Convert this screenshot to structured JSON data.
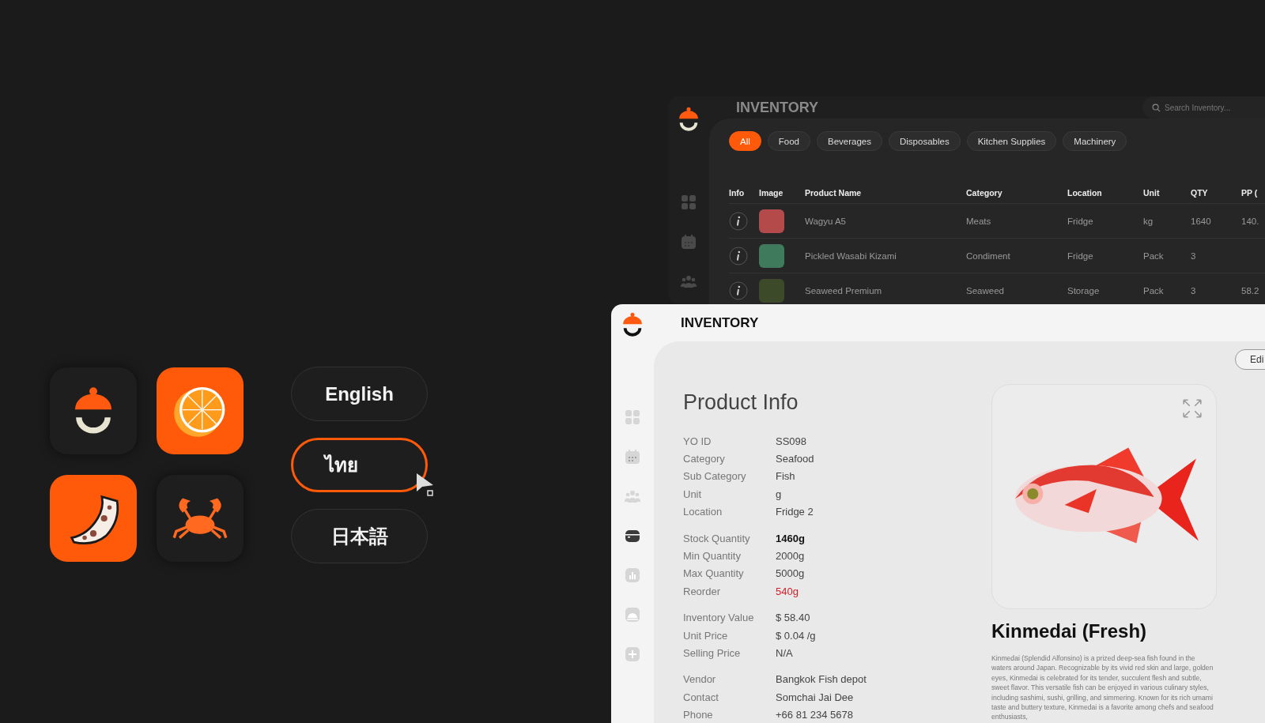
{
  "app_icons": [
    {
      "kind": "cloche"
    },
    {
      "kind": "orange"
    },
    {
      "kind": "pizza"
    },
    {
      "kind": "crab"
    }
  ],
  "languages": [
    {
      "label": "English",
      "selected": false
    },
    {
      "label": "ไทย",
      "selected": true
    },
    {
      "label": "日本語",
      "selected": false
    }
  ],
  "inventory_window": {
    "title": "INVENTORY",
    "search": {
      "placeholder": "Search Inventory..."
    },
    "filters": [
      {
        "label": "All",
        "selected": true
      },
      {
        "label": "Food",
        "selected": false
      },
      {
        "label": "Beverages",
        "selected": false
      },
      {
        "label": "Disposables",
        "selected": false
      },
      {
        "label": "Kitchen Supplies",
        "selected": false
      },
      {
        "label": "Machinery",
        "selected": false
      }
    ],
    "nav": [
      {
        "kind": "grid"
      },
      {
        "kind": "calendar"
      },
      {
        "kind": "people"
      }
    ],
    "table": {
      "columns": [
        "Info",
        "Image",
        "Product Name",
        "Category",
        "Location",
        "Unit",
        "QTY",
        "PP ("
      ],
      "rows": [
        {
          "name": "Wagyu A5",
          "category": "Meats",
          "location": "Fridge",
          "unit": "kg",
          "qty": "1640",
          "pp": "140."
        },
        {
          "name": "Pickled Wasabi Kizami",
          "category": "Condiment",
          "location": "Fridge",
          "unit": "Pack",
          "qty": "3",
          "pp": ""
        },
        {
          "name": "Seaweed Premium",
          "category": "Seaweed",
          "location": "Storage",
          "unit": "Pack",
          "qty": "3",
          "pp": "58.2"
        }
      ]
    }
  },
  "product_window": {
    "title": "INVENTORY",
    "edit_button": "Edi",
    "nav": [
      {
        "kind": "grid",
        "selected": false
      },
      {
        "kind": "calendar",
        "selected": false
      },
      {
        "kind": "people",
        "selected": false
      },
      {
        "kind": "box",
        "selected": true
      },
      {
        "kind": "chart",
        "selected": false
      },
      {
        "kind": "cloche",
        "selected": false
      },
      {
        "kind": "plus",
        "selected": false
      }
    ],
    "heading": "Product Info",
    "sections": [
      [
        {
          "label": "YO ID",
          "value": "SS098",
          "kind": "normal"
        },
        {
          "label": "Category",
          "value": "Seafood",
          "kind": "normal"
        },
        {
          "label": "Sub Category",
          "value": "Fish",
          "kind": "normal"
        },
        {
          "label": "Unit",
          "value": "g",
          "kind": "normal"
        },
        {
          "label": "Location",
          "value": "Fridge 2",
          "kind": "normal"
        }
      ],
      [
        {
          "label": "Stock Quantity",
          "value": "1460g",
          "kind": "emphasis"
        },
        {
          "label": "Min Quantity",
          "value": "2000g",
          "kind": "normal"
        },
        {
          "label": "Max Quantity",
          "value": "5000g",
          "kind": "normal"
        },
        {
          "label": "Reorder",
          "value": "540g",
          "kind": "alert"
        }
      ],
      [
        {
          "label": "Inventory Value",
          "value": "$ 58.40",
          "kind": "normal"
        },
        {
          "label": "Unit Price",
          "value": "$ 0.04 /g",
          "kind": "normal"
        },
        {
          "label": "Selling Price",
          "value": "N/A",
          "kind": "normal"
        }
      ],
      [
        {
          "label": "Vendor",
          "value": "Bangkok Fish depot",
          "kind": "normal"
        },
        {
          "label": "Contact",
          "value": "Somchai Jai Dee",
          "kind": "normal"
        },
        {
          "label": "Phone",
          "value": "+66 81 234 5678",
          "kind": "normal"
        }
      ]
    ],
    "product_name": "Kinmedai (Fresh)",
    "description": "Kinmedai (Splendid Alfonsino) is a prized deep-sea fish found in the waters around Japan. Recognizable by its vivid red skin and large, golden eyes, Kinmedai is celebrated for its tender, succulent flesh and subtle, sweet flavor. This versatile fish can be enjoyed in various culinary styles, including sashimi, sushi, grilling, and simmering. Known for its rich umami taste and buttery texture, Kinmedai is a favorite among chefs and seafood enthusiasts,"
  }
}
